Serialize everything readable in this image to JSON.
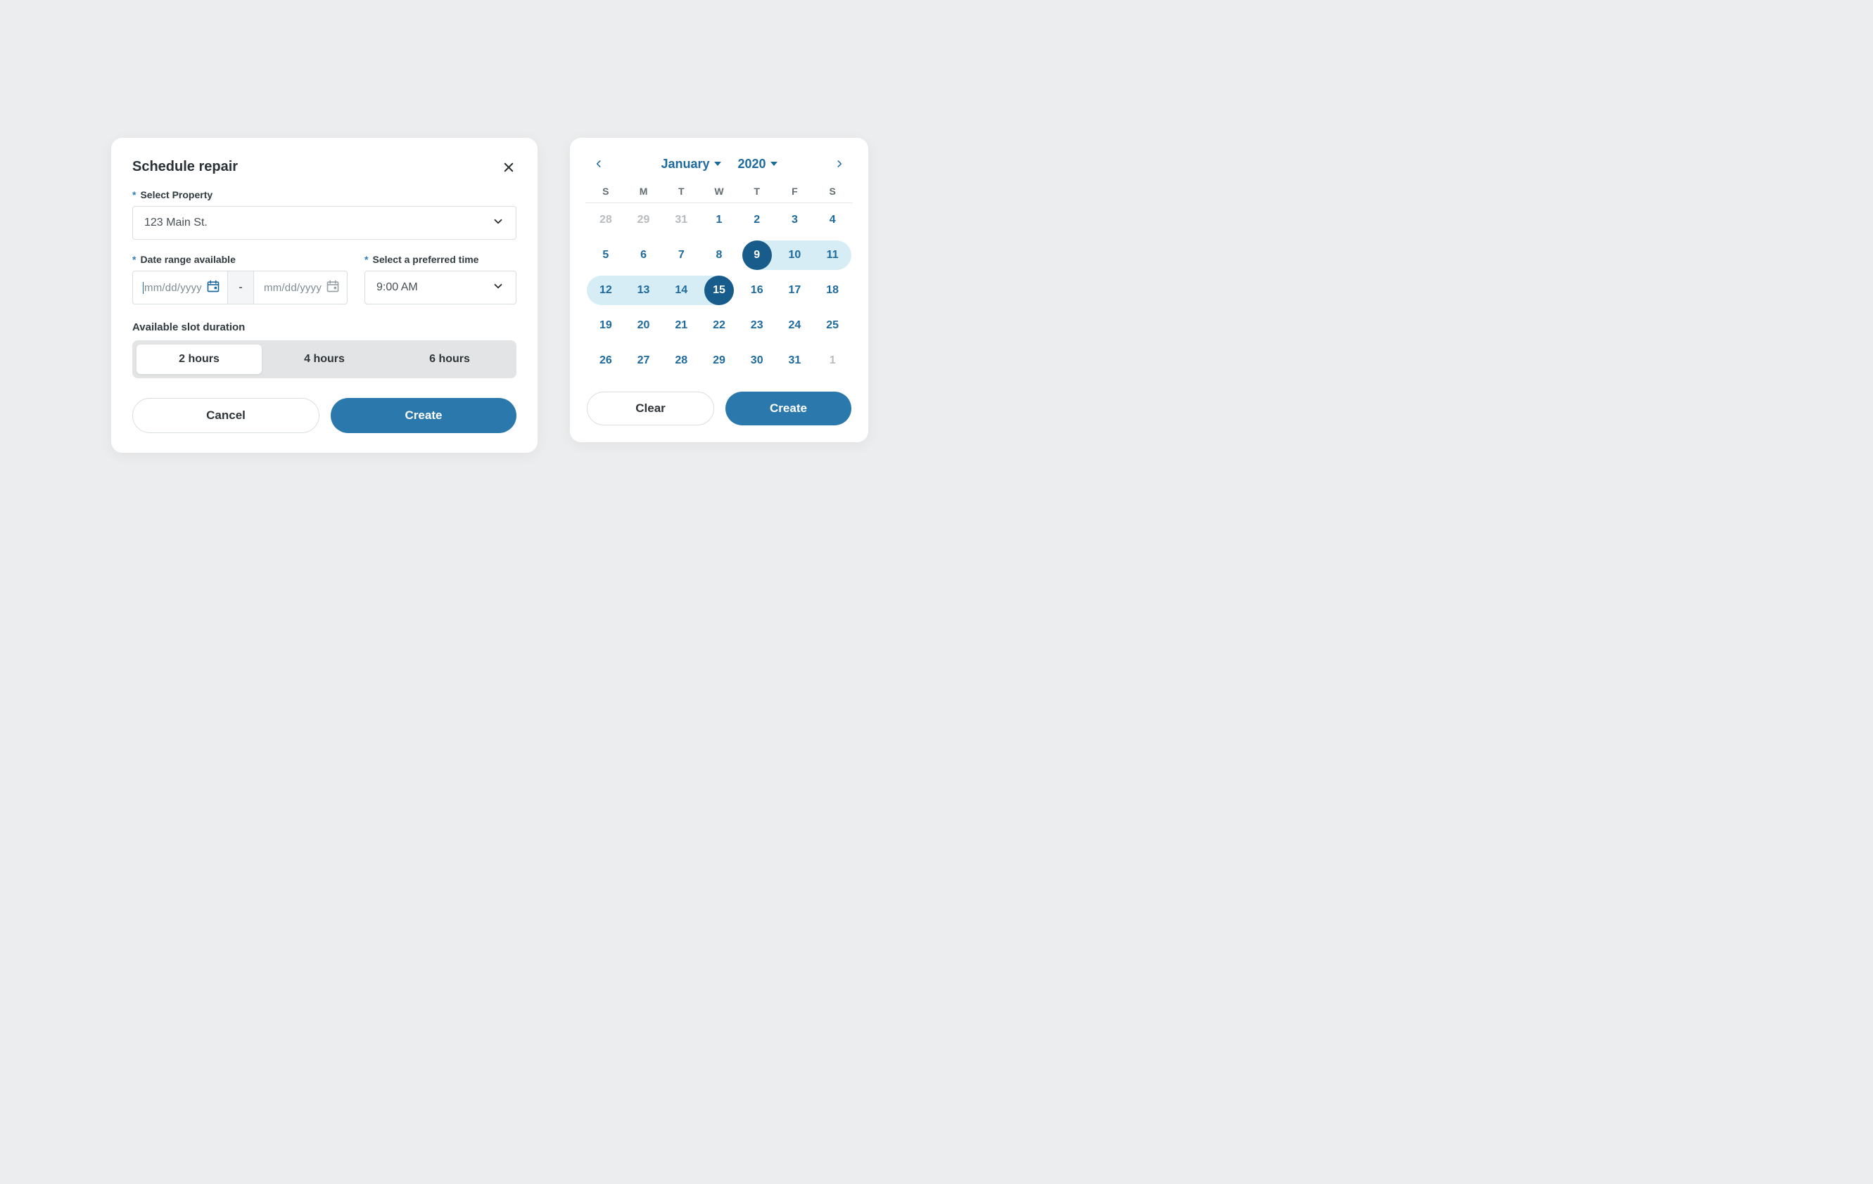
{
  "schedule": {
    "title": "Schedule repair",
    "property": {
      "label": "Select Property",
      "value": "123 Main St."
    },
    "dateRange": {
      "label": "Date range available",
      "startPlaceholder": "mm/dd/yyyy",
      "endPlaceholder": "mm/dd/yyyy",
      "separator": "-"
    },
    "time": {
      "label": "Select a preferred time",
      "value": "9:00 AM"
    },
    "duration": {
      "label": "Available slot duration",
      "options": [
        "2 hours",
        "4 hours",
        "6 hours"
      ],
      "selected": "2 hours"
    },
    "cancel": "Cancel",
    "create": "Create"
  },
  "calendar": {
    "month": "January",
    "year": "2020",
    "dow": [
      "S",
      "M",
      "T",
      "W",
      "T",
      "F",
      "S"
    ],
    "weeks": [
      [
        {
          "n": "28",
          "out": true
        },
        {
          "n": "29",
          "out": true
        },
        {
          "n": "31",
          "out": true
        },
        {
          "n": "1"
        },
        {
          "n": "2"
        },
        {
          "n": "3"
        },
        {
          "n": "4"
        }
      ],
      [
        {
          "n": "5"
        },
        {
          "n": "6"
        },
        {
          "n": "7"
        },
        {
          "n": "8"
        },
        {
          "n": "9",
          "selEnd": true,
          "range": true,
          "first": true
        },
        {
          "n": "10",
          "range": true
        },
        {
          "n": "11",
          "range": true,
          "rowEnd": true
        }
      ],
      [
        {
          "n": "12",
          "range": true,
          "rowStart": true
        },
        {
          "n": "13",
          "range": true
        },
        {
          "n": "14",
          "range": true
        },
        {
          "n": "15",
          "selEnd": true,
          "range": true,
          "last": true
        },
        {
          "n": "16"
        },
        {
          "n": "17"
        },
        {
          "n": "18"
        }
      ],
      [
        {
          "n": "19"
        },
        {
          "n": "20"
        },
        {
          "n": "21"
        },
        {
          "n": "22"
        },
        {
          "n": "23"
        },
        {
          "n": "24"
        },
        {
          "n": "25"
        }
      ],
      [
        {
          "n": "26"
        },
        {
          "n": "27"
        },
        {
          "n": "28"
        },
        {
          "n": "29"
        },
        {
          "n": "30"
        },
        {
          "n": "31"
        },
        {
          "n": "1",
          "out": true
        }
      ]
    ],
    "clear": "Clear",
    "create": "Create"
  }
}
